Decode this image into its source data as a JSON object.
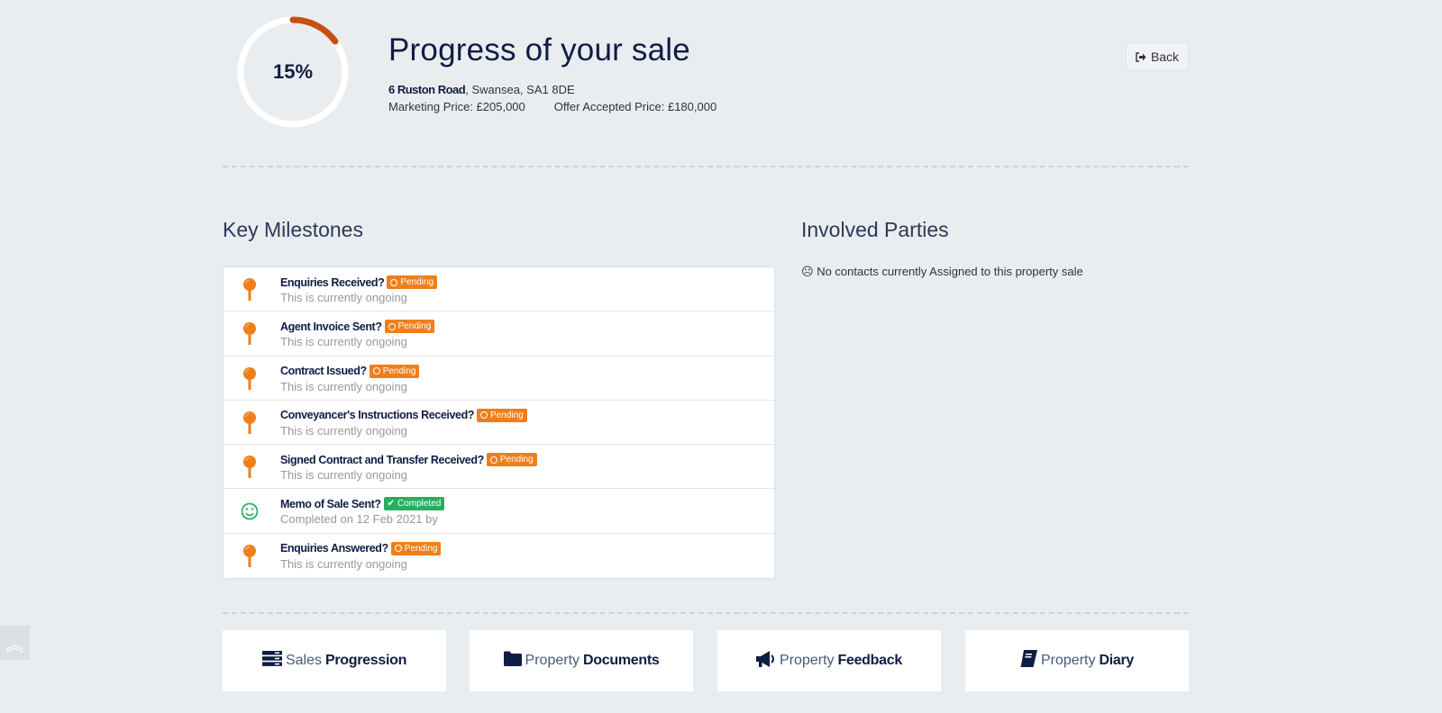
{
  "header": {
    "progress_percent": 15,
    "progress_label": "15%",
    "title": "Progress of your sale",
    "address_street": "6 Ruston Road",
    "address_rest": ", Swansea, SA1 8DE",
    "marketing_price": "Marketing Price: £205,000",
    "offer_price": "Offer Accepted Price: £180,000",
    "back_label": "Back",
    "colors": {
      "progress": "#c94f0c",
      "track": "#ffffff"
    }
  },
  "milestones": {
    "heading": "Key Milestones",
    "items": [
      {
        "title": "Enquiries Received?",
        "status": "Pending",
        "sub": "This is currently ongoing",
        "icon": "map-pin-icon"
      },
      {
        "title": "Agent Invoice Sent?",
        "status": "Pending",
        "sub": "This is currently ongoing",
        "icon": "map-pin-icon"
      },
      {
        "title": "Contract Issued?",
        "status": "Pending",
        "sub": "This is currently ongoing",
        "icon": "map-pin-icon"
      },
      {
        "title": "Conveyancer's Instructions Received?",
        "status": "Pending",
        "sub": "This is currently ongoing",
        "icon": "map-pin-icon"
      },
      {
        "title": "Signed Contract and Transfer Received?",
        "status": "Pending",
        "sub": "This is currently ongoing",
        "icon": "map-pin-icon"
      },
      {
        "title": "Memo of Sale Sent?",
        "status": "Completed",
        "sub": "Completed on 12 Feb 2021 by",
        "icon": "smile-icon"
      },
      {
        "title": "Enquiries Answered?",
        "status": "Pending",
        "sub": "This is currently ongoing",
        "icon": "map-pin-icon"
      }
    ]
  },
  "parties": {
    "heading": "Involved Parties",
    "empty": "No contacts currently Assigned to this property sale"
  },
  "cards": [
    {
      "light": "Sales",
      "bold": "Progression",
      "icon": "server-icon"
    },
    {
      "light": "Property",
      "bold": "Documents",
      "icon": "folder-icon"
    },
    {
      "light": "Property",
      "bold": "Feedback",
      "icon": "megaphone-icon"
    },
    {
      "light": "Property",
      "bold": "Diary",
      "icon": "book-icon"
    }
  ]
}
